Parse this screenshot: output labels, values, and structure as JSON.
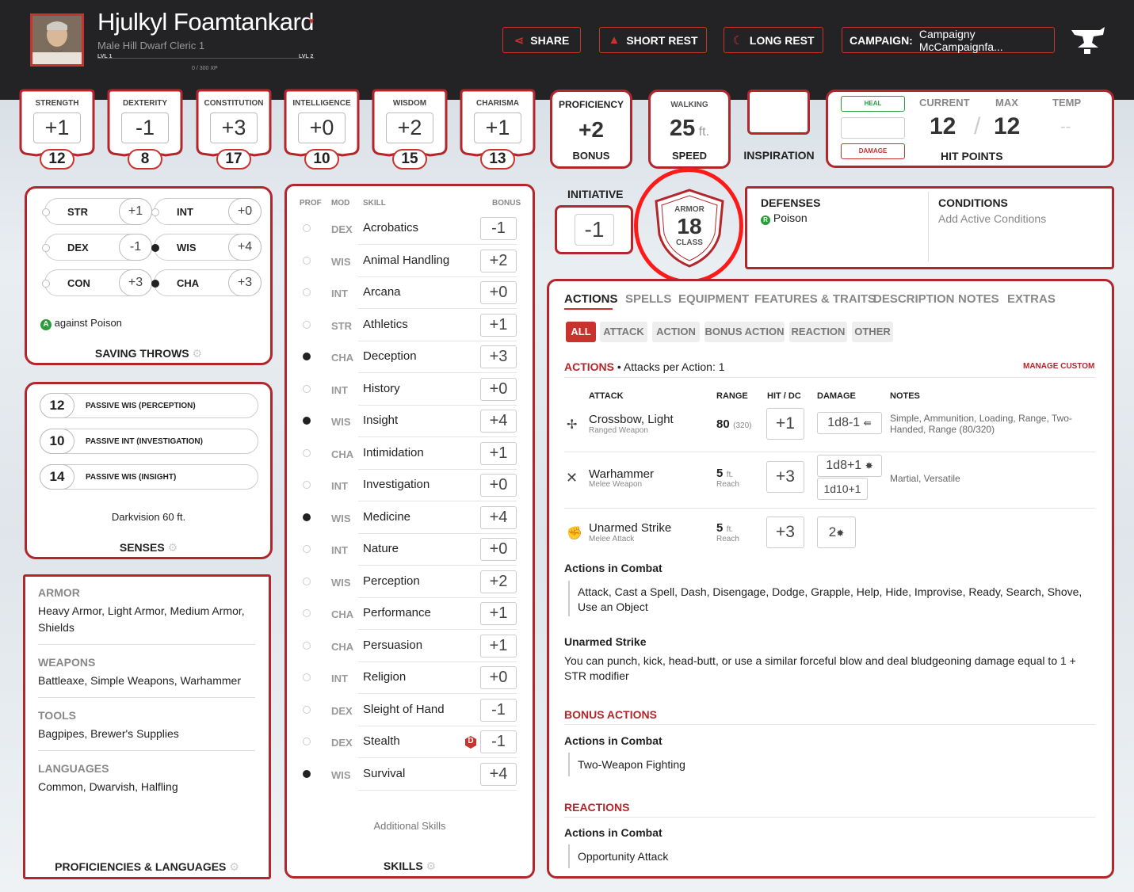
{
  "header": {
    "name": "Hjulkyl Foamtankard",
    "subtitle": "Male  Hill Dwarf  Cleric 1",
    "xp_start": "LVL 1",
    "xp_end": "LVL 2",
    "xp": "0 / 300 XP",
    "buttons": {
      "share": "SHARE",
      "short_rest": "SHORT REST",
      "long_rest": "LONG REST"
    },
    "campaign_label": "CAMPAIGN:",
    "campaign_name": "Campaigny McCampaignfa..."
  },
  "abilities": [
    {
      "name": "STRENGTH",
      "mod": "+1",
      "score": "12"
    },
    {
      "name": "DEXTERITY",
      "mod": "-1",
      "score": "8"
    },
    {
      "name": "CONSTITUTION",
      "mod": "+3",
      "score": "17"
    },
    {
      "name": "INTELLIGENCE",
      "mod": "+0",
      "score": "10"
    },
    {
      "name": "WISDOM",
      "mod": "+2",
      "score": "15"
    },
    {
      "name": "CHARISMA",
      "mod": "+1",
      "score": "13"
    }
  ],
  "proficiency": {
    "top": "PROFICIENCY",
    "value": "+2",
    "bottom": "BONUS"
  },
  "speed": {
    "top": "WALKING",
    "value": "25",
    "unit": "ft.",
    "bottom": "SPEED"
  },
  "inspiration": "INSPIRATION",
  "hp": {
    "heal": "HEAL",
    "damage": "DAMAGE",
    "current_label": "CURRENT",
    "max_label": "MAX",
    "temp_label": "TEMP",
    "current": "12",
    "slash": "/",
    "max": "12",
    "temp": "--",
    "footer": "HIT POINTS"
  },
  "initiative": {
    "label": "INITIATIVE",
    "value": "-1"
  },
  "armor": {
    "top": "ARMOR",
    "value": "18",
    "bottom": "CLASS"
  },
  "defenses": {
    "title": "DEFENSES",
    "value": "Poison",
    "conditions_title": "CONDITIONS",
    "conditions_value": "Add Active Conditions"
  },
  "saving_throws": {
    "items": [
      {
        "abbr": "STR",
        "mod": "+1",
        "prof": false
      },
      {
        "abbr": "INT",
        "mod": "+0",
        "prof": false
      },
      {
        "abbr": "DEX",
        "mod": "-1",
        "prof": false
      },
      {
        "abbr": "WIS",
        "mod": "+4",
        "prof": true
      },
      {
        "abbr": "CON",
        "mod": "+3",
        "prof": false
      },
      {
        "abbr": "CHA",
        "mod": "+3",
        "prof": true
      }
    ],
    "note_badge": "A",
    "note": "against Poison",
    "footer": "SAVING THROWS"
  },
  "senses": {
    "items": [
      {
        "value": "12",
        "label": "PASSIVE WIS (PERCEPTION)"
      },
      {
        "value": "10",
        "label": "PASSIVE INT (INVESTIGATION)"
      },
      {
        "value": "14",
        "label": "PASSIVE WIS (INSIGHT)"
      }
    ],
    "darkvision": "Darkvision 60 ft.",
    "footer": "SENSES"
  },
  "proficiencies": {
    "armor_h": "ARMOR",
    "armor": "Heavy Armor, Light Armor, Medium Armor, Shields",
    "weapons_h": "WEAPONS",
    "weapons": "Battleaxe, Simple Weapons, Warhammer",
    "tools_h": "TOOLS",
    "tools": "Bagpipes, Brewer's Supplies",
    "languages_h": "LANGUAGES",
    "languages": "Common, Dwarvish, Halfling",
    "footer": "PROFICIENCIES & LANGUAGES"
  },
  "skills": {
    "headers": {
      "prof": "PROF",
      "mod": "MOD",
      "skill": "SKILL",
      "bonus": "BONUS"
    },
    "rows": [
      {
        "prof": false,
        "mod": "DEX",
        "name": "Acrobatics",
        "bonus": "-1"
      },
      {
        "prof": false,
        "mod": "WIS",
        "name": "Animal Handling",
        "bonus": "+2"
      },
      {
        "prof": false,
        "mod": "INT",
        "name": "Arcana",
        "bonus": "+0"
      },
      {
        "prof": false,
        "mod": "STR",
        "name": "Athletics",
        "bonus": "+1"
      },
      {
        "prof": true,
        "mod": "CHA",
        "name": "Deception",
        "bonus": "+3"
      },
      {
        "prof": false,
        "mod": "INT",
        "name": "History",
        "bonus": "+0"
      },
      {
        "prof": true,
        "mod": "WIS",
        "name": "Insight",
        "bonus": "+4"
      },
      {
        "prof": false,
        "mod": "CHA",
        "name": "Intimidation",
        "bonus": "+1"
      },
      {
        "prof": false,
        "mod": "INT",
        "name": "Investigation",
        "bonus": "+0"
      },
      {
        "prof": true,
        "mod": "WIS",
        "name": "Medicine",
        "bonus": "+4"
      },
      {
        "prof": false,
        "mod": "INT",
        "name": "Nature",
        "bonus": "+0"
      },
      {
        "prof": false,
        "mod": "WIS",
        "name": "Perception",
        "bonus": "+2"
      },
      {
        "prof": false,
        "mod": "CHA",
        "name": "Performance",
        "bonus": "+1"
      },
      {
        "prof": false,
        "mod": "CHA",
        "name": "Persuasion",
        "bonus": "+1"
      },
      {
        "prof": false,
        "mod": "INT",
        "name": "Religion",
        "bonus": "+0"
      },
      {
        "prof": false,
        "mod": "DEX",
        "name": "Sleight of Hand",
        "bonus": "-1"
      },
      {
        "prof": false,
        "mod": "DEX",
        "name": "Stealth",
        "bonus": "-1"
      },
      {
        "prof": true,
        "mod": "WIS",
        "name": "Survival",
        "bonus": "+4"
      }
    ],
    "disadvantage_badge": "D",
    "additional": "Additional Skills",
    "footer": "SKILLS"
  },
  "actions": {
    "tabs": [
      "ACTIONS",
      "SPELLS",
      "EQUIPMENT",
      "FEATURES & TRAITS",
      "DESCRIPTION",
      "NOTES",
      "EXTRAS"
    ],
    "filters": [
      "ALL",
      "ATTACK",
      "ACTION",
      "BONUS ACTION",
      "REACTION",
      "OTHER"
    ],
    "section_title": "ACTIONS",
    "per_action": "• Attacks per Action: 1",
    "manage": "MANAGE CUSTOM",
    "cols": {
      "attack": "ATTACK",
      "range": "RANGE",
      "hit": "HIT / DC",
      "damage": "DAMAGE",
      "notes": "NOTES"
    },
    "attacks": [
      {
        "name": "Crossbow, Light",
        "sub": "Ranged Weapon",
        "range": "80",
        "range2": "(320)",
        "hit": "+1",
        "damage": "1d8-1",
        "notes": "Simple, Ammunition, Loading, Range, Two-Handed, Range (80/320)"
      },
      {
        "name": "Warhammer",
        "sub": "Melee Weapon",
        "range": "5",
        "range_unit": "ft.",
        "range_sub": "Reach",
        "hit": "+3",
        "damage": "1d8+1",
        "damage2": "1d10+1",
        "notes": "Martial, Versatile"
      },
      {
        "name": "Unarmed Strike",
        "sub": "Melee Attack",
        "range": "5",
        "range_unit": "ft.",
        "range_sub": "Reach",
        "hit": "+3",
        "damage": "2"
      }
    ],
    "combat_title": "Actions in Combat",
    "combat_list": "Attack, Cast a Spell, Dash, Disengage, Dodge, Grapple, Help, Hide, Improvise, Ready, Search, Shove, Use an Object",
    "unarmed_title": "Unarmed Strike",
    "unarmed_text": "You can punch, kick, head-butt, or use a similar forceful blow and deal bludgeoning damage equal to 1 + STR modifier",
    "bonus_title": "BONUS ACTIONS",
    "bonus_sub": "Actions in Combat",
    "bonus_item": "Two-Weapon Fighting",
    "reactions_title": "REACTIONS",
    "reactions_sub": "Actions in Combat",
    "reactions_item": "Opportunity Attack"
  },
  "colors": {
    "accent": "#c8342d",
    "frame": "#b3262b",
    "header_bg": "#232325",
    "annotation": "#ff1a1a"
  }
}
